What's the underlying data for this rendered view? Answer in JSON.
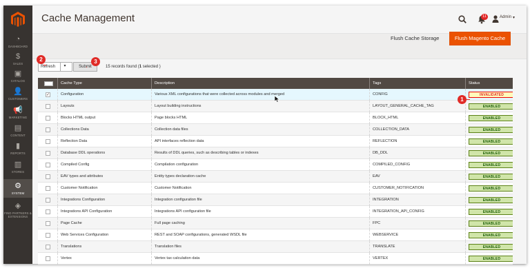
{
  "sidebar": {
    "items": [
      {
        "label": "DASHBOARD",
        "icon": "dashboard-icon"
      },
      {
        "label": "SALES",
        "icon": "dollar-icon"
      },
      {
        "label": "CATALOG",
        "icon": "box-icon"
      },
      {
        "label": "CUSTOMERS",
        "icon": "person-icon"
      },
      {
        "label": "MARKETING",
        "icon": "megaphone-icon"
      },
      {
        "label": "CONTENT",
        "icon": "layout-icon"
      },
      {
        "label": "REPORTS",
        "icon": "bar-chart-icon"
      },
      {
        "label": "STORES",
        "icon": "store-icon"
      },
      {
        "label": "SYSTEM",
        "icon": "gear-icon"
      },
      {
        "label": "FIND PARTNERS & EXTENSIONS",
        "icon": "cube-icon"
      }
    ]
  },
  "header": {
    "title": "Cache Management",
    "notifications_count": "11",
    "user_name": "Admin"
  },
  "actions": {
    "flush_cache_storage": "Flush Cache Storage",
    "flush_magento_cache": "Flush Magento Cache"
  },
  "massaction": {
    "selected_option": "Refresh",
    "submit_label": "Submit",
    "records_count": "15",
    "records_text": "records found",
    "selected_open": "(",
    "selected_count": "1",
    "selected_close": "selected )"
  },
  "callouts": [
    "1",
    "2",
    "3"
  ],
  "table": {
    "columns": [
      "Cache Type",
      "Description",
      "Tags",
      "Status"
    ],
    "rows": [
      {
        "type": "Configuration",
        "description": "Various XML configurations that were collected across modules and merged",
        "tags": "CONFIG",
        "status": "INVALIDATED",
        "checked": true
      },
      {
        "type": "Layouts",
        "description": "Layout building instructions",
        "tags": "LAYOUT_GENERAL_CACHE_TAG",
        "status": "ENABLED",
        "checked": false
      },
      {
        "type": "Blocks HTML output",
        "description": "Page blocks HTML",
        "tags": "BLOCK_HTML",
        "status": "ENABLED",
        "checked": false
      },
      {
        "type": "Collections Data",
        "description": "Collection data files",
        "tags": "COLLECTION_DATA",
        "status": "ENABLED",
        "checked": false
      },
      {
        "type": "Reflection Data",
        "description": "API interfaces reflection data",
        "tags": "REFLECTION",
        "status": "ENABLED",
        "checked": false
      },
      {
        "type": "Database DDL operations",
        "description": "Results of DDL queries, such as describing tables or indexes",
        "tags": "DB_DDL",
        "status": "ENABLED",
        "checked": false
      },
      {
        "type": "Compiled Config",
        "description": "Compilation configuration",
        "tags": "COMPILED_CONFIG",
        "status": "ENABLED",
        "checked": false
      },
      {
        "type": "EAV types and attributes",
        "description": "Entity types declaration cache",
        "tags": "EAV",
        "status": "ENABLED",
        "checked": false
      },
      {
        "type": "Customer Notification",
        "description": "Customer Notification",
        "tags": "CUSTOMER_NOTIFICATION",
        "status": "ENABLED",
        "checked": false
      },
      {
        "type": "Integrations Configuration",
        "description": "Integration configuration file",
        "tags": "INTEGRATION",
        "status": "ENABLED",
        "checked": false
      },
      {
        "type": "Integrations API Configuration",
        "description": "Integrations API configuration file",
        "tags": "INTEGRATION_API_CONFIG",
        "status": "ENABLED",
        "checked": false
      },
      {
        "type": "Page Cache",
        "description": "Full page caching",
        "tags": "FPC",
        "status": "ENABLED",
        "checked": false
      },
      {
        "type": "Web Services Configuration",
        "description": "REST and SOAP configurations, generated WSDL file",
        "tags": "WEBSERVICE",
        "status": "ENABLED",
        "checked": false
      },
      {
        "type": "Translations",
        "description": "Translation files",
        "tags": "TRANSLATE",
        "status": "ENABLED",
        "checked": false
      },
      {
        "type": "Vertex",
        "description": "Vertex tax calculation data",
        "tags": "VERTEX",
        "status": "ENABLED",
        "checked": false
      }
    ]
  },
  "colors": {
    "sidebar_bg": "#373330",
    "accent_orange": "#eb5202",
    "grid_header": "#514943",
    "enabled_bg": "#d0e5a9",
    "invalid_bg": "#fffbbb",
    "callout_red": "#e02b27"
  }
}
